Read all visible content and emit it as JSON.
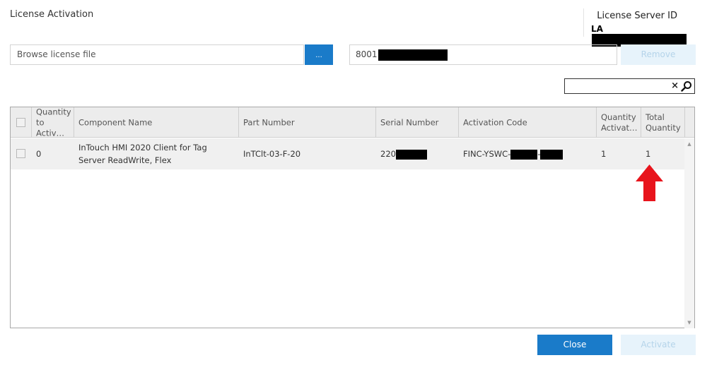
{
  "dialog": {
    "title": "License Activation",
    "server_id_label": "License Server ID",
    "server_id_value_prefix": "LA"
  },
  "browse": {
    "placeholder": "Browse license file",
    "button_label": "..."
  },
  "serial_input": {
    "value_prefix": "8001"
  },
  "buttons": {
    "remove": "Remove",
    "close": "Close",
    "activate": "Activate"
  },
  "search": {
    "value": "",
    "clear_label": "×",
    "icon": "search-icon"
  },
  "table": {
    "columns": [
      "Quantity to Activ…",
      "Component Name",
      "Part Number",
      "Serial Number",
      "Activation Code",
      "Quantity Activat…",
      "Total Quantity"
    ],
    "rows": [
      {
        "quantity_to_activate": "0",
        "component_name": "InTouch HMI 2020 Client for Tag Server ReadWrite, Flex",
        "part_number": "InTClt-03-F-20",
        "serial_number_prefix": "220",
        "activation_code_prefix": "FINC-YSWC-",
        "activation_code_sep": "-",
        "quantity_activated": "1",
        "total_quantity": "1"
      }
    ]
  },
  "colors": {
    "primary": "#1a7bc9",
    "disabled_bg": "#e7f3fb",
    "annotation_arrow": "#e8141c"
  }
}
